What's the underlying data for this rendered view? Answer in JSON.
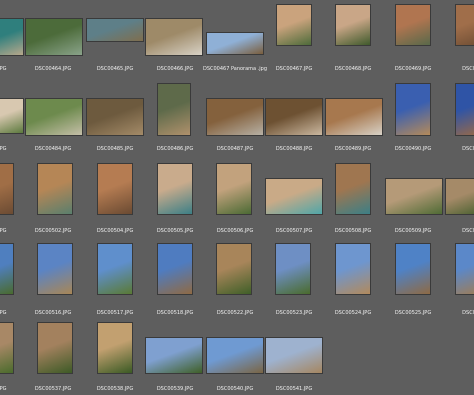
{
  "thumbnails": [
    {
      "caption": "...JPG",
      "colors": [
        "#2f7f7d",
        "#b7a88b"
      ]
    },
    {
      "caption": "DSC00464.JPG",
      "colors": [
        "#4c6b3a",
        "#8aa38a"
      ]
    },
    {
      "caption": "DSC00465.JPG",
      "colors": [
        "#5e7f88",
        "#7f6e4e"
      ]
    },
    {
      "caption": "DSC00466.JPG",
      "colors": [
        "#9e8a68",
        "#d8d2c6"
      ]
    },
    {
      "caption": "DSC00467 Panorama .jpg",
      "colors": [
        "#8fb0d6",
        "#7a5e3d"
      ]
    },
    {
      "caption": "DSC00467.JPG",
      "colors": [
        "#caa37d",
        "#4d6b3a"
      ]
    },
    {
      "caption": "DSC00468.JPG",
      "colors": [
        "#c9a687",
        "#3f5a2c"
      ]
    },
    {
      "caption": "DSC00469.JPG",
      "colors": [
        "#b07550",
        "#59694a"
      ]
    },
    {
      "caption": "DSC00...",
      "colors": [
        "#a06e4a",
        "#6d4d34"
      ]
    },
    {
      "caption": "...JPG",
      "colors": [
        "#d8c8b0",
        "#5c7a3e"
      ]
    },
    {
      "caption": "DSC00484.JPG",
      "colors": [
        "#6d8a4d",
        "#c5bfa8"
      ]
    },
    {
      "caption": "DSC00485.JPG",
      "colors": [
        "#6d5a3e",
        "#a48b68"
      ]
    },
    {
      "caption": "DSC00486.JPG",
      "colors": [
        "#5e6a4a",
        "#b0916c"
      ]
    },
    {
      "caption": "DSC00487.JPG",
      "colors": [
        "#84613d",
        "#b7b1a5"
      ]
    },
    {
      "caption": "DSC00488.JPG",
      "colors": [
        "#6d5132",
        "#cbb8a0"
      ]
    },
    {
      "caption": "DSC00489.JPG",
      "colors": [
        "#a7784e",
        "#d8d2c7"
      ]
    },
    {
      "caption": "DSC00490.JPG",
      "colors": [
        "#3a5fb0",
        "#b48a5a"
      ]
    },
    {
      "caption": "DSC00...",
      "colors": [
        "#2f54a6",
        "#9c6a44"
      ]
    },
    {
      "caption": "...JPG",
      "colors": [
        "#a06e46",
        "#6b4b33"
      ]
    },
    {
      "caption": "DSC00502.JPG",
      "colors": [
        "#b58656",
        "#5a7f6d"
      ]
    },
    {
      "caption": "DSC00504.JPG",
      "colors": [
        "#b57c52",
        "#6a4a32"
      ]
    },
    {
      "caption": "DSC00505.JPG",
      "colors": [
        "#c9ab8c",
        "#3c7f86"
      ]
    },
    {
      "caption": "DSC00506.JPG",
      "colors": [
        "#c2a27d",
        "#4b6a34"
      ]
    },
    {
      "caption": "DSC00507.JPG",
      "colors": [
        "#c9aa87",
        "#4fa6a8"
      ]
    },
    {
      "caption": "DSC00508.JPG",
      "colors": [
        "#9f7650",
        "#3c7f86"
      ]
    },
    {
      "caption": "DSC00509.JPG",
      "colors": [
        "#b59a78",
        "#4f6b35"
      ]
    },
    {
      "caption": "DSC00...",
      "colors": [
        "#a58a68",
        "#465f2e"
      ]
    },
    {
      "caption": "...JPG",
      "colors": [
        "#4f7fbf",
        "#4a6b2e"
      ]
    },
    {
      "caption": "DSC00516.JPG",
      "colors": [
        "#5b84c4",
        "#a88656"
      ]
    },
    {
      "caption": "DSC00517.JPG",
      "colors": [
        "#5f8fcc",
        "#5a7a34"
      ]
    },
    {
      "caption": "DSC00518.JPG",
      "colors": [
        "#4f7cc0",
        "#8f6a44"
      ]
    },
    {
      "caption": "DSC00522.JPG",
      "colors": [
        "#a8855a",
        "#3f5f28"
      ]
    },
    {
      "caption": "DSC00523.JPG",
      "colors": [
        "#6e8fc4",
        "#4a6b2c"
      ]
    },
    {
      "caption": "DSC00524.JPG",
      "colors": [
        "#6e96cf",
        "#b28a5c"
      ]
    },
    {
      "caption": "DSC00525.JPG",
      "colors": [
        "#4f82c6",
        "#8e6a44"
      ]
    },
    {
      "caption": "DSC00...",
      "colors": [
        "#5b88c9",
        "#a07c52"
      ]
    },
    {
      "caption": "...JPG",
      "colors": [
        "#a88866",
        "#4a6b2c"
      ]
    },
    {
      "caption": "DSC00537.JPG",
      "colors": [
        "#a3815e",
        "#3d5a26"
      ]
    },
    {
      "caption": "DSC00538.JPG",
      "colors": [
        "#c2a070",
        "#3a5a24"
      ]
    },
    {
      "caption": "DSC00539.JPG",
      "colors": [
        "#7fa0d0",
        "#3f5f26"
      ]
    },
    {
      "caption": "DSC00540.JPG",
      "colors": [
        "#6f9ad2",
        "#7a6544"
      ]
    },
    {
      "caption": "DSC00541.JPG",
      "colors": [
        "#9eb2cf",
        "#a58660"
      ]
    }
  ]
}
